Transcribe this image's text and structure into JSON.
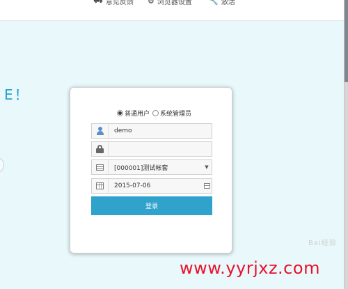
{
  "topbar": {
    "feedback_label": "意见反馈",
    "browser_settings_label": "浏览器设置",
    "activate_label": "激活",
    "icons": [
      "truck-icon",
      "gear-icon",
      "wrench-icon"
    ]
  },
  "welcome_fragment": "E！",
  "login": {
    "user_type_options": [
      "普通用户",
      "系统管理员"
    ],
    "selected_user_type": "普通用户",
    "username_value": "demo",
    "password_value": "",
    "account_set_value": "[000001]测试帐套",
    "date_value": "2015-07-06",
    "login_button_label": "登录"
  },
  "watermark": {
    "logo_text": "Bai经验",
    "url": "www.yyrjxz.com"
  },
  "colors": {
    "content_bg": "#e8f8fb",
    "accent": "#2fa3cc",
    "watermark_red": "#e8102a"
  }
}
